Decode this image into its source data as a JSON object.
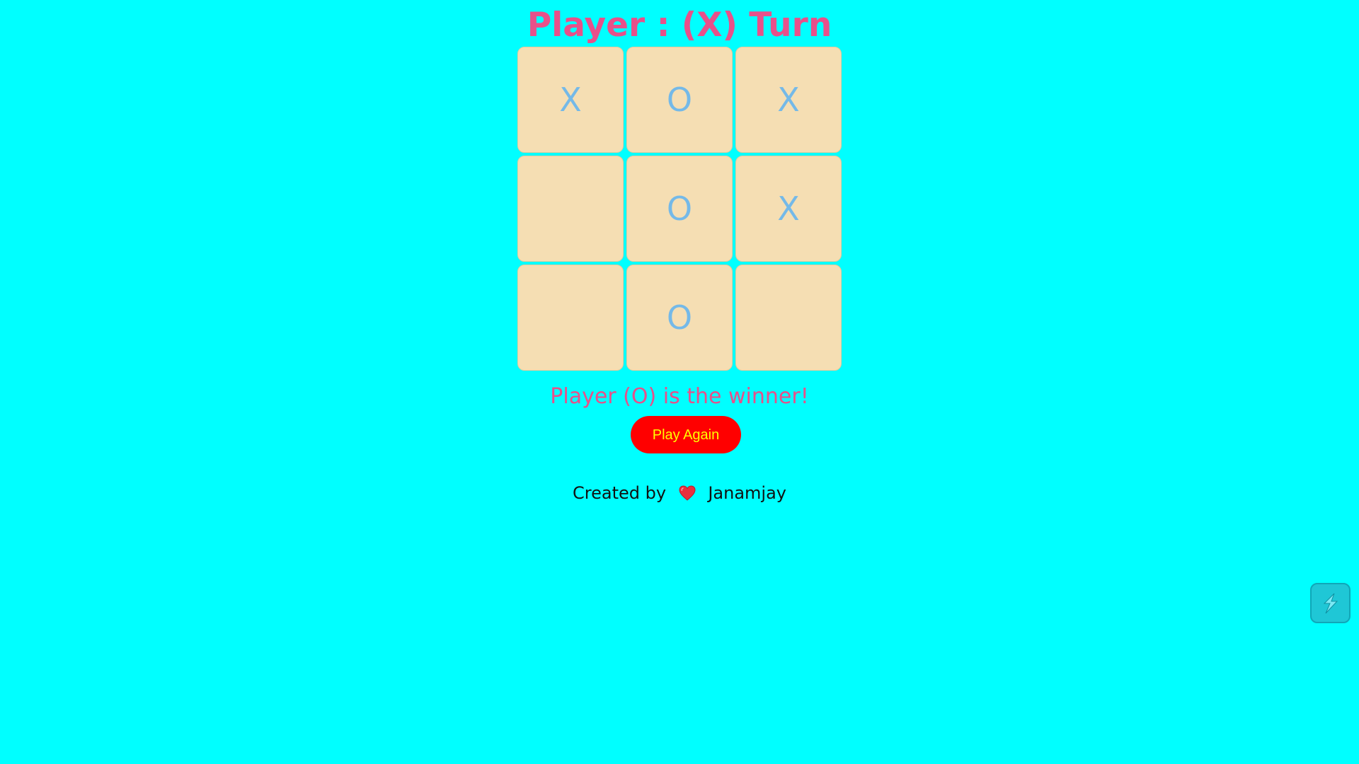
{
  "status": {
    "turn_text": "Player : (X) Turn",
    "winner_text": "Player (O) is the winner!"
  },
  "board": {
    "cells": [
      "X",
      "O",
      "X",
      "",
      "O",
      "X",
      "",
      "O",
      ""
    ]
  },
  "actions": {
    "play_again_label": "Play Again"
  },
  "footer": {
    "prefix": "Created by",
    "author": "Janamjay",
    "icon": "heart-icon"
  },
  "floating_button": {
    "icon": "lightning-icon"
  },
  "colors": {
    "background": "#00ffff",
    "title": "#e8508a",
    "cell": "#f5deb3",
    "mark": "#74b9e8",
    "button_bg": "#ff0000",
    "button_text": "#ffff00"
  }
}
